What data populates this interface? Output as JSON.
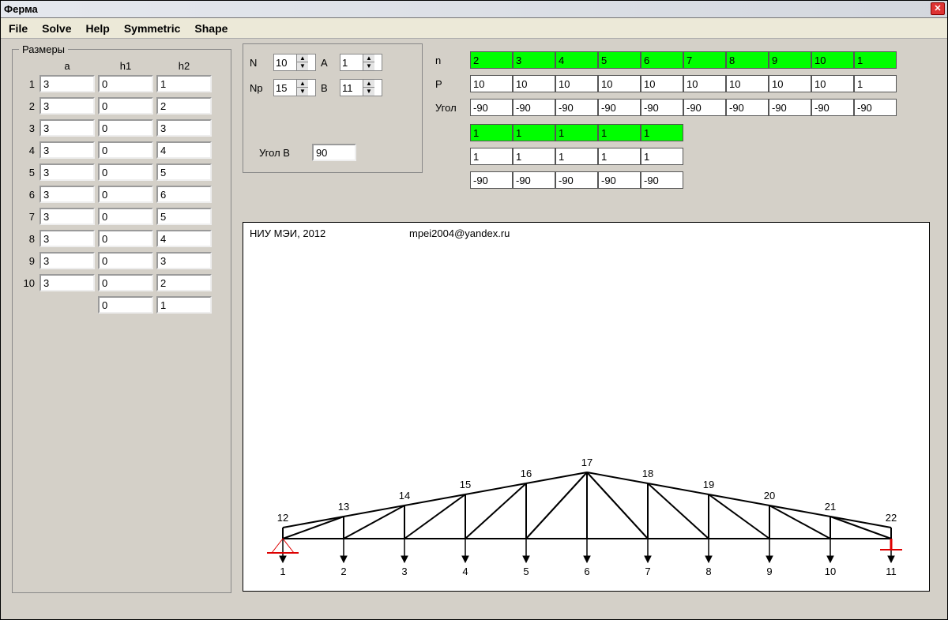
{
  "window": {
    "title": "Ферма"
  },
  "menu": {
    "file": "File",
    "solve": "Solve",
    "help": "Help",
    "symmetric": "Symmetric",
    "shape": "Shape"
  },
  "sizes": {
    "legend": "Размеры",
    "headers": {
      "a": "a",
      "h1": "h1",
      "h2": "h2"
    },
    "rows": [
      {
        "n": "1",
        "a": "3",
        "h1": "0",
        "h2": "1"
      },
      {
        "n": "2",
        "a": "3",
        "h1": "0",
        "h2": "2"
      },
      {
        "n": "3",
        "a": "3",
        "h1": "0",
        "h2": "3"
      },
      {
        "n": "4",
        "a": "3",
        "h1": "0",
        "h2": "4"
      },
      {
        "n": "5",
        "a": "3",
        "h1": "0",
        "h2": "5"
      },
      {
        "n": "6",
        "a": "3",
        "h1": "0",
        "h2": "6"
      },
      {
        "n": "7",
        "a": "3",
        "h1": "0",
        "h2": "5"
      },
      {
        "n": "8",
        "a": "3",
        "h1": "0",
        "h2": "4"
      },
      {
        "n": "9",
        "a": "3",
        "h1": "0",
        "h2": "3"
      },
      {
        "n": "10",
        "a": "3",
        "h1": "0",
        "h2": "2"
      }
    ],
    "extra": {
      "h1": "0",
      "h2": "1"
    }
  },
  "params": {
    "N_label": "N",
    "N": "10",
    "A_label": "A",
    "A": "1",
    "Np_label": "Np",
    "Np": "15",
    "B_label": "B",
    "B": "11",
    "angleB_label": "Угол B",
    "angleB": "90"
  },
  "loads": {
    "n_label": "n",
    "P_label": "P",
    "angle_label": "Угол",
    "n": [
      "2",
      "3",
      "4",
      "5",
      "6",
      "7",
      "8",
      "9",
      "10",
      "1"
    ],
    "P": [
      "10",
      "10",
      "10",
      "10",
      "10",
      "10",
      "10",
      "10",
      "10",
      "1"
    ],
    "angle": [
      "-90",
      "-90",
      "-90",
      "-90",
      "-90",
      "-90",
      "-90",
      "-90",
      "-90",
      "-90"
    ],
    "n2": [
      "1",
      "1",
      "1",
      "1",
      "1"
    ],
    "P2": [
      "1",
      "1",
      "1",
      "1",
      "1"
    ],
    "angle2": [
      "-90",
      "-90",
      "-90",
      "-90",
      "-90"
    ]
  },
  "canvas": {
    "credit": "НИУ МЭИ, 2012",
    "email": "mpei2004@yandex.ru",
    "bottom_nodes": [
      "1",
      "2",
      "3",
      "4",
      "5",
      "6",
      "7",
      "8",
      "9",
      "10",
      "11"
    ],
    "top_nodes": [
      "12",
      "13",
      "14",
      "15",
      "16",
      "17",
      "18",
      "19",
      "20",
      "21",
      "22"
    ]
  }
}
